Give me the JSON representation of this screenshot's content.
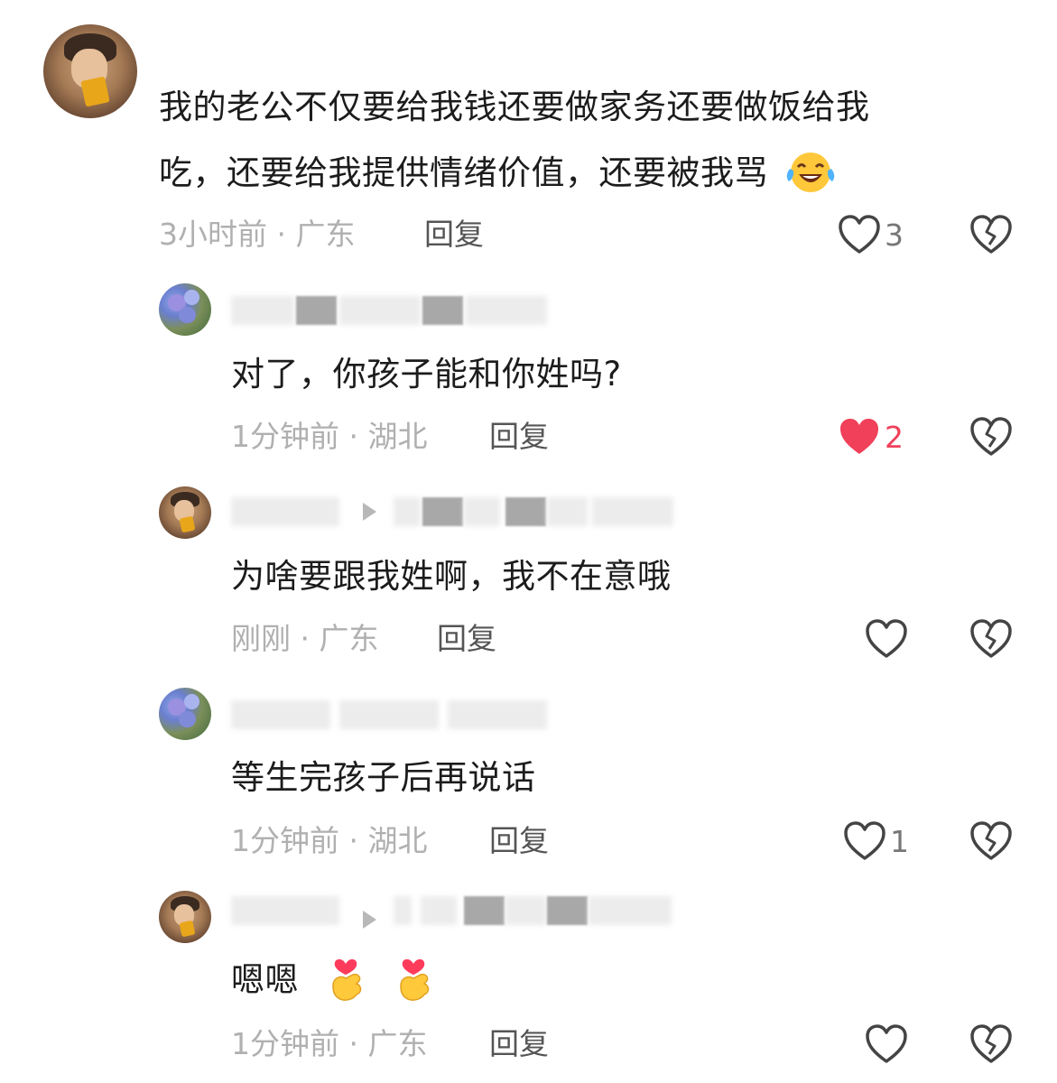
{
  "comments": [
    {
      "text_lines": [
        "我的老公不仅要给我钱还要做家务还要做饭给我",
        "吃，还要给我提供情绪价值，还要被我骂"
      ],
      "emoji": "laughing-crying-emoji",
      "time": "3小时前",
      "location": "广东",
      "reply_label": "回复",
      "likes": "3",
      "liked": false
    },
    {
      "text": "对了，你孩子能和你姓吗?",
      "time": "1分钟前",
      "location": "湖北",
      "reply_label": "回复",
      "likes": "2",
      "liked": true
    },
    {
      "text": "为啥要跟我姓啊，我不在意哦",
      "time": "刚刚",
      "location": "广东",
      "reply_label": "回复",
      "likes": "",
      "liked": false
    },
    {
      "text": "等生完孩子后再说话",
      "time": "1分钟前",
      "location": "湖北",
      "reply_label": "回复",
      "likes": "1",
      "liked": false
    },
    {
      "text": "嗯嗯",
      "emoji": [
        "finger-heart-emoji",
        "finger-heart-emoji"
      ],
      "time": "1分钟前",
      "location": "广东",
      "reply_label": "回复",
      "likes": "",
      "liked": false
    }
  ],
  "colors": {
    "liked_heart": "#f0405a",
    "meta_text": "#b0b0b0",
    "icon_outline": "#444444"
  },
  "separator": " · "
}
